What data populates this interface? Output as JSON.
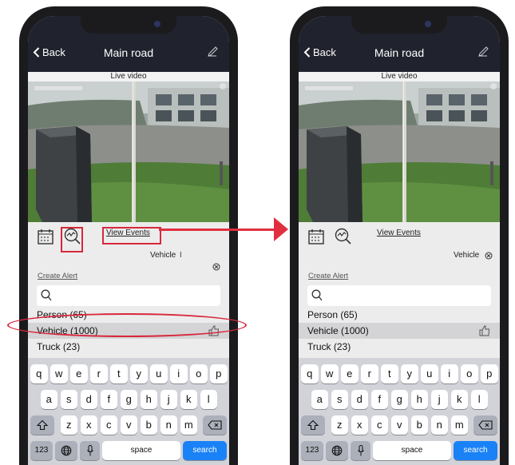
{
  "colors": {
    "accent_red": "#d7283c",
    "keyboard_blue": "#1a82f7",
    "nav_bg": "#20232d"
  },
  "screens": [
    {
      "nav": {
        "back_label": "Back",
        "title": "Main road"
      },
      "video": {
        "label": "Live video"
      },
      "toolbar": {
        "view_events_label": "View Events"
      },
      "filter_tag": {
        "label": "Vehicle",
        "cursor": "I"
      },
      "create_alert_label": "Create Alert",
      "search": {
        "placeholder": ""
      },
      "list": [
        {
          "label": "Person (65)",
          "selected": false
        },
        {
          "label": "Vehicle (1000)",
          "selected": true
        },
        {
          "label": "Truck (23)",
          "selected": false
        }
      ]
    },
    {
      "nav": {
        "back_label": "Back",
        "title": "Main road"
      },
      "video": {
        "label": "Live video"
      },
      "toolbar": {
        "view_events_label": "View Events"
      },
      "filter_tag": {
        "label": "Vehicle",
        "cursor": ""
      },
      "create_alert_label": "Create Alert",
      "search": {
        "placeholder": ""
      },
      "list": [
        {
          "label": "Person (65)",
          "selected": false
        },
        {
          "label": "Vehicle (1000)",
          "selected": true
        },
        {
          "label": "Truck (23)",
          "selected": false
        }
      ]
    }
  ],
  "keyboard": {
    "row1": [
      "q",
      "w",
      "e",
      "r",
      "t",
      "y",
      "u",
      "i",
      "o",
      "p"
    ],
    "row2": [
      "a",
      "s",
      "d",
      "f",
      "g",
      "h",
      "j",
      "k",
      "l"
    ],
    "row3": [
      "z",
      "x",
      "c",
      "v",
      "b",
      "n",
      "m"
    ],
    "numbers_label": "123",
    "space_label": "space",
    "search_label": "search"
  },
  "icons": {
    "back": "chevron-left-icon",
    "edit": "pencil-icon",
    "calendar": "calendar-icon",
    "analytics": "magnifier-chart-icon",
    "clear": "circle-x-icon",
    "search": "search-icon",
    "like": "thumbs-up-icon",
    "shift": "shift-arrow-icon",
    "delete": "backspace-icon",
    "globe": "globe-icon",
    "mic": "microphone-icon"
  }
}
